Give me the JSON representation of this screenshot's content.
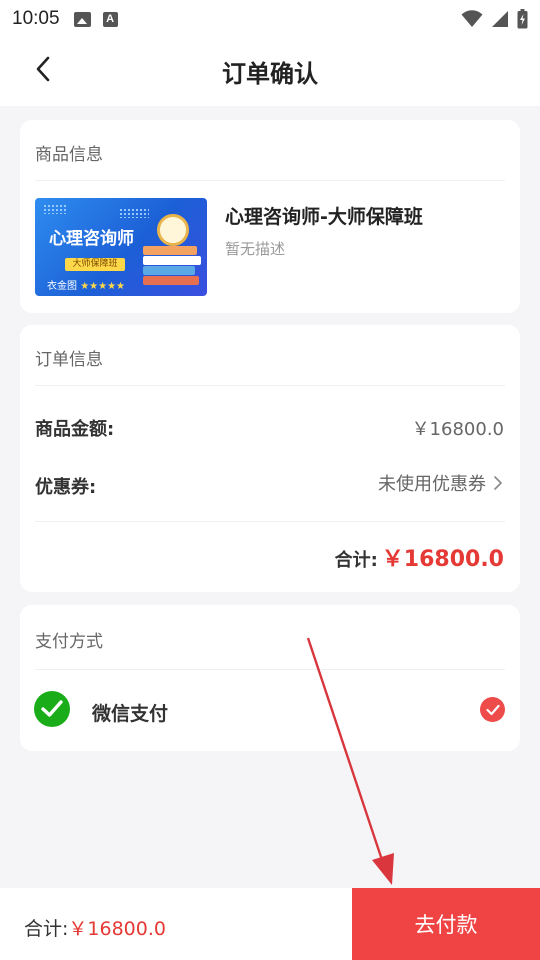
{
  "status_bar": {
    "time": "10:05",
    "icons": [
      "image-icon",
      "a-icon",
      "wifi-icon",
      "signal-icon",
      "battery-icon"
    ]
  },
  "nav": {
    "title": "订单确认",
    "back_icon": "chevron-left-icon"
  },
  "product_section": {
    "title": "商品信息",
    "thumbnail": {
      "title": "心理咨询师",
      "tag": "大师保障班",
      "brand": "衣金图",
      "stars": "★★★★★"
    },
    "name": "心理咨询师-大师保障班",
    "description": "暂无描述"
  },
  "order_section": {
    "title": "订单信息",
    "amount_label": "商品金额:",
    "amount_value": "￥16800.0",
    "coupon_label": "优惠券:",
    "coupon_value": "未使用优惠券",
    "total_label": "合计:",
    "total_value": "￥16800.0"
  },
  "payment_section": {
    "title": "支付方式",
    "method": "微信支付",
    "selected": true
  },
  "bottom_bar": {
    "total_label": "合计:",
    "total_value": "￥16800.0",
    "pay_button": "去付款"
  },
  "colors": {
    "accent_red": "#e53935",
    "button_red": "#f04444",
    "wechat_green": "#1aad19",
    "annotation_red": "#d9363e"
  }
}
